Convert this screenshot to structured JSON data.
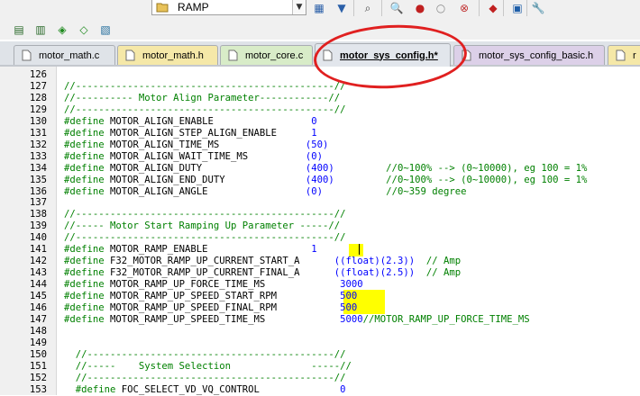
{
  "toolbar": {
    "build_target": "RAMP",
    "buttons_row1": [
      {
        "name": "build-config-icon",
        "glyph": "▦"
      },
      {
        "name": "download-icon",
        "glyph": "▼"
      },
      {
        "name": "find-in-files-icon",
        "glyph": "⌕"
      },
      {
        "name": "debug-start-icon",
        "glyph": "🔍"
      },
      {
        "name": "breakpoint-insert-icon",
        "glyph": "●"
      },
      {
        "name": "breakpoint-disable-icon",
        "glyph": "○"
      },
      {
        "name": "breakpoint-kill-all-icon",
        "glyph": "⊗"
      },
      {
        "name": "breakpoint-clear-icon",
        "glyph": "◆"
      },
      {
        "name": "window-layout-icon",
        "glyph": "▣"
      },
      {
        "name": "configure-icon",
        "glyph": "🔧"
      }
    ],
    "buttons_row2": [
      {
        "name": "translate-icon",
        "glyph": "▤"
      },
      {
        "name": "build-icon",
        "glyph": "▥"
      },
      {
        "name": "rebuild-icon",
        "glyph": "◈"
      },
      {
        "name": "batch-build-icon",
        "glyph": "◇"
      },
      {
        "name": "stop-build-icon",
        "glyph": "▧"
      }
    ]
  },
  "tabs": [
    {
      "label": "motor_math.c",
      "active": false,
      "color": "#dfe3e8"
    },
    {
      "label": "motor_math.h",
      "active": false,
      "color": "#f5e8a8"
    },
    {
      "label": "motor_core.c",
      "active": false,
      "color": "#d8ecc8"
    },
    {
      "label": "motor_sys_config.h*",
      "active": true,
      "color": "#e2e6ec"
    },
    {
      "label": "motor_sys_config_basic.h",
      "active": false,
      "color": "#dcd0e8"
    },
    {
      "label": "r",
      "active": false,
      "color": "#f5e8a8"
    }
  ],
  "lines": [
    {
      "n": "126",
      "parts": []
    },
    {
      "n": "127",
      "parts": [
        {
          "t": "//---------------------------------------------//",
          "c": "comment"
        }
      ]
    },
    {
      "n": "128",
      "parts": [
        {
          "t": "//---------- Motor Align Parameter------------//",
          "c": "comment"
        }
      ]
    },
    {
      "n": "129",
      "parts": [
        {
          "t": "//---------------------------------------------//",
          "c": "comment"
        }
      ]
    },
    {
      "n": "130",
      "parts": [
        {
          "t": "#define ",
          "c": "pp"
        },
        {
          "t": "MOTOR_ALIGN_ENABLE                 ",
          "c": "text"
        },
        {
          "t": "0",
          "c": "num"
        }
      ]
    },
    {
      "n": "131",
      "parts": [
        {
          "t": "#define ",
          "c": "pp"
        },
        {
          "t": "MOTOR_ALIGN_STEP_ALIGN_ENABLE      ",
          "c": "text"
        },
        {
          "t": "1",
          "c": "num"
        }
      ]
    },
    {
      "n": "132",
      "parts": [
        {
          "t": "#define ",
          "c": "pp"
        },
        {
          "t": "MOTOR_ALIGN_TIME_MS               ",
          "c": "text"
        },
        {
          "t": "(50)",
          "c": "num"
        }
      ]
    },
    {
      "n": "133",
      "parts": [
        {
          "t": "#define ",
          "c": "pp"
        },
        {
          "t": "MOTOR_ALIGN_WAIT_TIME_MS          ",
          "c": "text"
        },
        {
          "t": "(0)",
          "c": "num"
        }
      ]
    },
    {
      "n": "134",
      "parts": [
        {
          "t": "#define ",
          "c": "pp"
        },
        {
          "t": "MOTOR_ALIGN_DUTY                  ",
          "c": "text"
        },
        {
          "t": "(400)",
          "c": "num"
        },
        {
          "t": "         //0~100% --> (0~10000), eg 100 = 1%",
          "c": "comment"
        }
      ]
    },
    {
      "n": "135",
      "parts": [
        {
          "t": "#define ",
          "c": "pp"
        },
        {
          "t": "MOTOR_ALIGN_END_DUTY              ",
          "c": "text"
        },
        {
          "t": "(400)",
          "c": "num"
        },
        {
          "t": "         //0~100% --> (0~10000), eg 100 = 1%",
          "c": "comment"
        }
      ]
    },
    {
      "n": "136",
      "parts": [
        {
          "t": "#define ",
          "c": "pp"
        },
        {
          "t": "MOTOR_ALIGN_ANGLE                 ",
          "c": "text"
        },
        {
          "t": "(0)",
          "c": "num"
        },
        {
          "t": "           //0~359 degree",
          "c": "comment"
        }
      ]
    },
    {
      "n": "137",
      "parts": []
    },
    {
      "n": "138",
      "parts": [
        {
          "t": "//---------------------------------------------//",
          "c": "comment"
        }
      ]
    },
    {
      "n": "139",
      "parts": [
        {
          "t": "//----- Motor Start Ramping Up Parameter -----//",
          "c": "comment"
        }
      ]
    },
    {
      "n": "140",
      "parts": [
        {
          "t": "//---------------------------------------------//",
          "c": "comment"
        }
      ]
    },
    {
      "n": "141",
      "parts": [
        {
          "t": "#define ",
          "c": "pp"
        },
        {
          "t": "MOTOR_RAMP_ENABLE                  ",
          "c": "text"
        },
        {
          "t": "1",
          "c": "num"
        }
      ]
    },
    {
      "n": "142",
      "parts": [
        {
          "t": "#define ",
          "c": "pp"
        },
        {
          "t": "F32_MOTOR_RAMP_UP_CURRENT_START_A      ",
          "c": "text"
        },
        {
          "t": "((float)(2.3))",
          "c": "num"
        },
        {
          "t": "  // Amp",
          "c": "comment"
        }
      ]
    },
    {
      "n": "143",
      "parts": [
        {
          "t": "#define ",
          "c": "pp"
        },
        {
          "t": "F32_MOTOR_RAMP_UP_CURRENT_FINAL_A      ",
          "c": "text"
        },
        {
          "t": "((float)(2.5))",
          "c": "num"
        },
        {
          "t": "  // Amp",
          "c": "comment"
        }
      ]
    },
    {
      "n": "144",
      "parts": [
        {
          "t": "#define ",
          "c": "pp"
        },
        {
          "t": "MOTOR_RAMP_UP_FORCE_TIME_MS             ",
          "c": "text"
        },
        {
          "t": "3000",
          "c": "num"
        }
      ]
    },
    {
      "n": "145",
      "parts": [
        {
          "t": "#define ",
          "c": "pp"
        },
        {
          "t": "MOTOR_RAMP_UP_SPEED_START_RPM           ",
          "c": "text"
        },
        {
          "t": "500",
          "c": "num"
        }
      ]
    },
    {
      "n": "146",
      "parts": [
        {
          "t": "#define ",
          "c": "pp"
        },
        {
          "t": "MOTOR_RAMP_UP_SPEED_FINAL_RPM           ",
          "c": "text"
        },
        {
          "t": "500",
          "c": "num"
        }
      ]
    },
    {
      "n": "147",
      "parts": [
        {
          "t": "#define ",
          "c": "pp"
        },
        {
          "t": "MOTOR_RAMP_UP_SPEED_TIME_MS             ",
          "c": "text"
        },
        {
          "t": "5000",
          "c": "num"
        },
        {
          "t": "//MOTOR_RAMP_UP_FORCE_TIME_MS",
          "c": "comment"
        }
      ]
    },
    {
      "n": "148",
      "parts": []
    },
    {
      "n": "149",
      "parts": []
    },
    {
      "n": "150",
      "parts": [
        {
          "t": "  //-------------------------------------------//",
          "c": "comment"
        }
      ]
    },
    {
      "n": "151",
      "parts": [
        {
          "t": "  //-----    System Selection              -----//",
          "c": "comment"
        }
      ]
    },
    {
      "n": "152",
      "parts": [
        {
          "t": "  //-------------------------------------------//",
          "c": "comment"
        }
      ]
    },
    {
      "n": "153",
      "parts": [
        {
          "t": "  #define ",
          "c": "pp"
        },
        {
          "t": "FOC_SELECT_VD_VQ_CONTROL              ",
          "c": "text"
        },
        {
          "t": "0",
          "c": "num"
        }
      ]
    }
  ]
}
